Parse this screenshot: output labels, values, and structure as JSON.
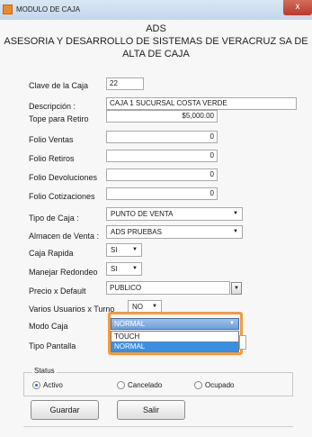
{
  "window": {
    "title": "MODULO DE CAJA",
    "close_label": "x"
  },
  "header": {
    "line1": "ADS",
    "line2": "ASESORIA Y DESARROLLO DE SISTEMAS DE VERACRUZ SA DE",
    "line3": "ALTA DE CAJA"
  },
  "form": {
    "clave_label": "Clave de la Caja",
    "clave_value": "22",
    "descripcion_label": "Descripción :",
    "descripcion_value": "CAJA 1 SUCURSAL COSTA VERDE",
    "tope_label": "Tope para Retiro",
    "tope_value": "$5,000.00",
    "folio_ventas_label": "Folio Ventas",
    "folio_ventas_value": "0",
    "folio_retiros_label": "Folio Retiros",
    "folio_retiros_value": "0",
    "folio_devoluciones_label": "Folio Devoluciones",
    "folio_devoluciones_value": "0",
    "folio_cotizaciones_label": "Folio Cotizaciones",
    "folio_cotizaciones_value": "0",
    "tipo_caja_label": "Tipo de Caja :",
    "tipo_caja_value": "PUNTO DE VENTA",
    "almacen_label": "Almacen de Venta :",
    "almacen_value": "ADS PRUEBAS",
    "caja_rapida_label": "Caja Rapida",
    "caja_rapida_value": "SI",
    "redondeo_label": "Manejar Redondeo",
    "redondeo_value": "SI",
    "precio_label": "Precio x Default",
    "precio_value": "PUBLICO",
    "varios_label": "Varios Usuarios x Turno",
    "varios_value": "NO",
    "modo_caja_label": "Modo Caja",
    "modo_caja_value": "NORMAL",
    "modo_caja_options": [
      "TOUCH",
      "NORMAL"
    ],
    "tipo_pantalla_label": "Tipo Pantalla"
  },
  "status": {
    "legend": "Status",
    "options": [
      "Activo",
      "Cancelado",
      "Ocupado"
    ],
    "selected": "Activo"
  },
  "buttons": {
    "guardar": "Guardar",
    "salir": "Salir"
  },
  "colors": {
    "highlight": "#f39a3e",
    "selection": "#3b8fe0"
  }
}
